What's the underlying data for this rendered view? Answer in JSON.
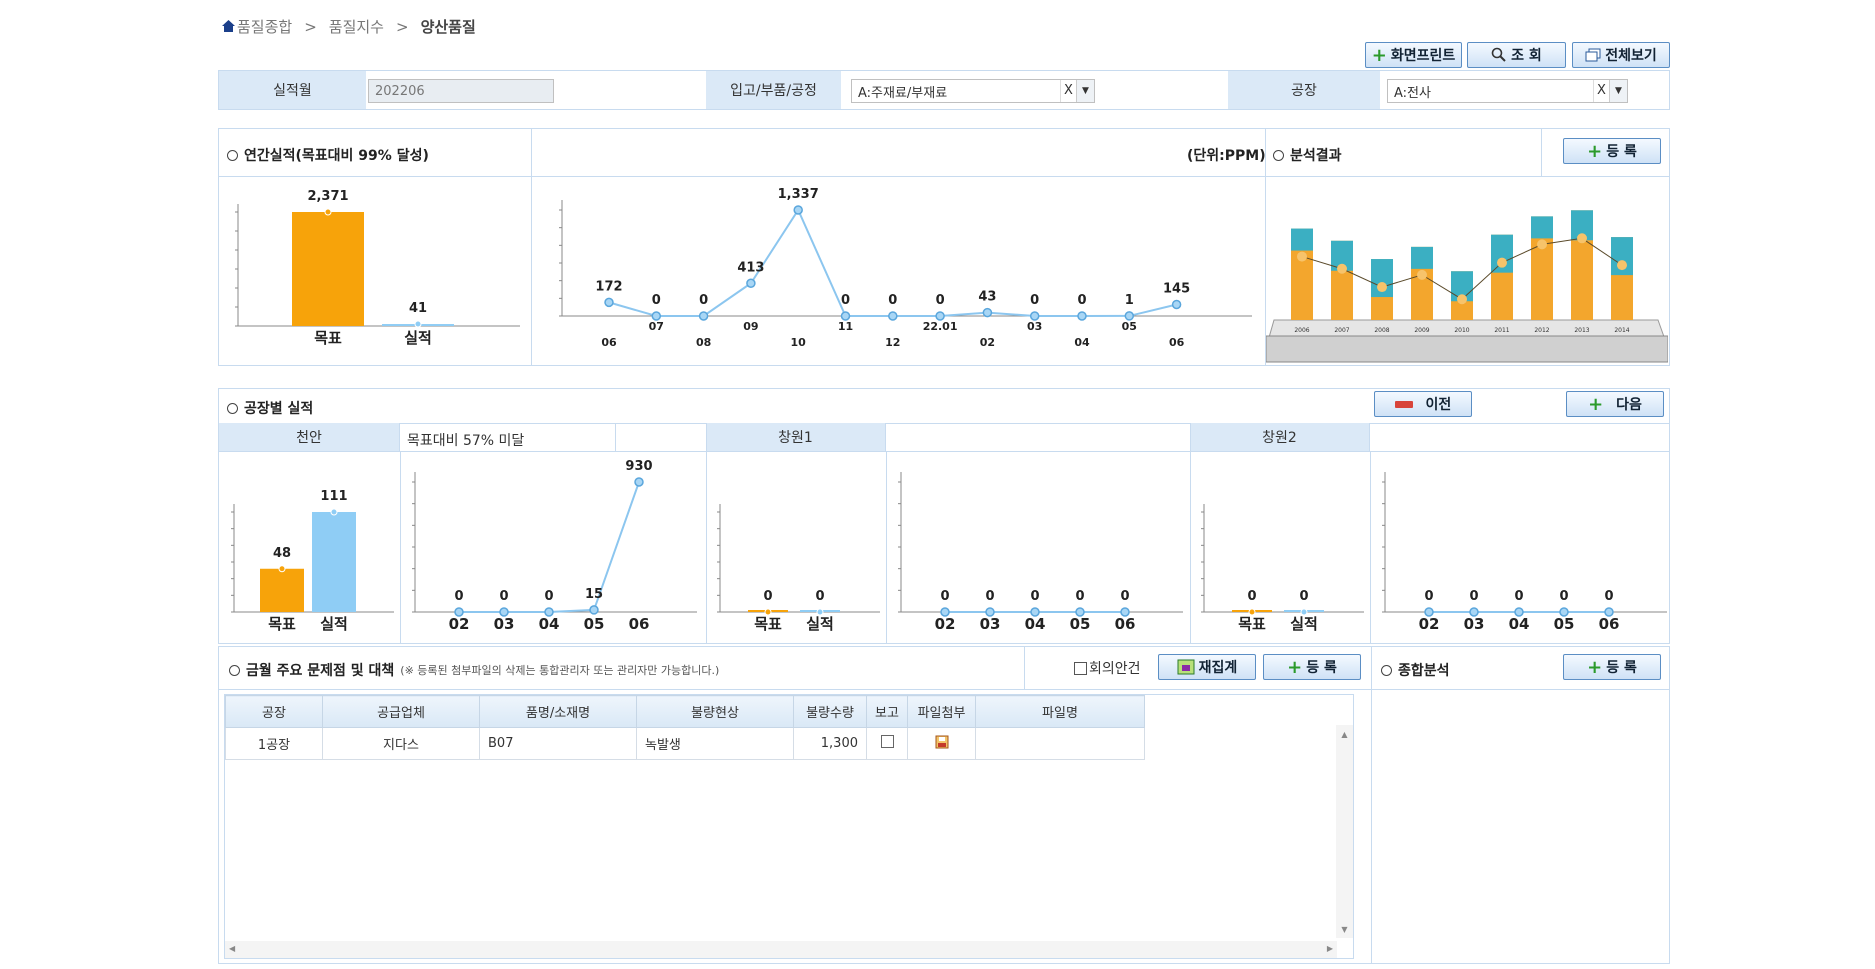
{
  "breadcrumb": {
    "home": "품질종합",
    "sep": ">",
    "level2": "품질지수",
    "current": "양산품질"
  },
  "toolbar": {
    "print": "화면프린트",
    "search": "조 회",
    "fullscreen": "전체보기"
  },
  "filters": {
    "month_label": "실적월",
    "month_value": "202206",
    "type_label": "입고/부품/공정",
    "type_value": "A:주재료/부재료",
    "plant_label": "공장",
    "plant_value": "A:전사",
    "clear": "X"
  },
  "annual": {
    "title": "연간실적(목표대비 99% 달성)",
    "unit": "(단위:PPM)",
    "analysis_title": "분석결과",
    "register": "등 록"
  },
  "chart_data": [
    {
      "type": "bar",
      "categories": [
        "목표",
        "실적"
      ],
      "values": [
        2371,
        41
      ],
      "labels": [
        "2,371",
        "41"
      ]
    },
    {
      "type": "line",
      "x": [
        "06",
        "07",
        "08",
        "09",
        "10",
        "11",
        "12",
        "22.01",
        "02",
        "03",
        "04",
        "05",
        "06"
      ],
      "values": [
        172,
        0,
        0,
        413,
        1337,
        0,
        0,
        0,
        43,
        0,
        0,
        1,
        145
      ],
      "labels": [
        "172",
        "0",
        "0",
        "413",
        "1,337",
        "0",
        "0",
        "0",
        "43",
        "0",
        "0",
        "1",
        "145"
      ]
    },
    {
      "type": "bar",
      "categories": [
        "2006",
        "2007",
        "2008",
        "2009",
        "2010",
        "2011",
        "2012",
        "2013",
        "2014"
      ],
      "values": [
        55,
        45,
        30,
        40,
        20,
        50,
        65,
        70,
        48
      ]
    },
    {
      "type": "bar",
      "categories": [
        "목표",
        "실적"
      ],
      "values": [
        48,
        111
      ]
    },
    {
      "type": "line",
      "x": [
        "02",
        "03",
        "04",
        "05",
        "06"
      ],
      "values": [
        0,
        0,
        0,
        15,
        930
      ]
    },
    {
      "type": "bar",
      "categories": [
        "목표",
        "실적"
      ],
      "values": [
        0,
        0
      ]
    },
    {
      "type": "line",
      "x": [
        "02",
        "03",
        "04",
        "05",
        "06"
      ],
      "values": [
        0,
        0,
        0,
        0,
        0
      ]
    },
    {
      "type": "bar",
      "categories": [
        "목표",
        "실적"
      ],
      "values": [
        0,
        0
      ]
    },
    {
      "type": "line",
      "x": [
        "02",
        "03",
        "04",
        "05",
        "06"
      ],
      "values": [
        0,
        0,
        0,
        0,
        0
      ]
    }
  ],
  "factory": {
    "title": "공장별 실적",
    "prev": "이전",
    "next": "다음",
    "p1": "천안",
    "p1_note": "목표대비 57% 미달",
    "p2": "창원1",
    "p3": "창원2"
  },
  "issues": {
    "title": "금월 주요 문제점 및 대책",
    "note": "(※ 등록된 첨부파일의 삭제는 통합관리자 또는 관리자만 가능합니다.)",
    "meeting": "회의안건",
    "recalc": "재집계",
    "register": "등 록",
    "summary_title": "종합분석",
    "summary_register": "등 록",
    "columns": [
      "공장",
      "공급업체",
      "품명/소재명",
      "불량현상",
      "불량수량",
      "보고",
      "파일첨부",
      "파일명"
    ],
    "rows": [
      {
        "plant": "1공장",
        "supplier": "지다스",
        "item": "B07",
        "defect": "녹발생",
        "qty": "1,300",
        "file": ""
      }
    ]
  },
  "colors": {
    "target": "#f7a30a",
    "actual": "#8fcdf5",
    "line": "#8cc6ef",
    "header": "#dbe9f7",
    "border": "#c8dbef"
  }
}
